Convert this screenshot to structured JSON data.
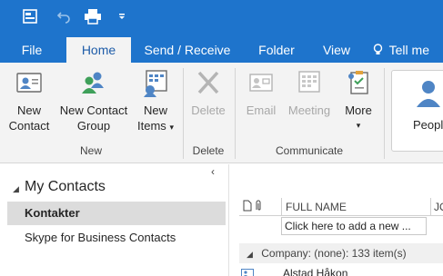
{
  "tabs": {
    "file": "File",
    "home": "Home",
    "send_receive": "Send / Receive",
    "folder": "Folder",
    "view": "View",
    "tell_me": "Tell me"
  },
  "ribbon": {
    "new_contact": [
      "New",
      "Contact"
    ],
    "new_contact_group": [
      "New Contact",
      "Group"
    ],
    "new_items": [
      "New",
      "Items"
    ],
    "delete": "Delete",
    "email": "Email",
    "meeting": "Meeting",
    "more": "More",
    "people": "People",
    "group_new": "New",
    "group_delete": "Delete",
    "group_communicate": "Communicate"
  },
  "nav": {
    "collapse": "‹",
    "title": "My Contacts",
    "items": [
      "Kontakter",
      "Skype for Business Contacts"
    ]
  },
  "list": {
    "col_full_name": "FULL NAME",
    "col_next": "JO",
    "add_new_placeholder": "Click here to add a new ...",
    "group_row": "Company: (none): 133 item(s)",
    "first_contact": "Alstad Håkon"
  },
  "colors": {
    "accent": "#1e74cc",
    "ribbon_bg": "#f3f3f3",
    "selected_bg": "#dcdcdc"
  }
}
